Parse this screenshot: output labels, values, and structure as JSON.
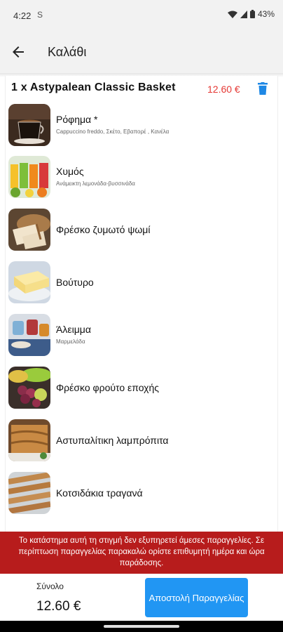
{
  "status": {
    "time": "4:22",
    "sim_icon": "S",
    "battery": "43%"
  },
  "header": {
    "title": "Καλάθι",
    "back_icon": "arrow-back-icon"
  },
  "basket": {
    "title": "1 x Astypalean Classic Basket",
    "price": "12.60 €",
    "price_color": "#e53935",
    "delete_icon": "trash-icon"
  },
  "items": [
    {
      "name": "Ρόφημα *",
      "sub": "Cappuccino freddo, Σκέτο, Εβαπορέ , Κανέλα"
    },
    {
      "name": "Χυμός",
      "sub": "Ανάμεικτη λεμονάδα-βυσσινάδα"
    },
    {
      "name": "Φρέσκο ζυμωτό ψωμί",
      "sub": ""
    },
    {
      "name": "Βούτυρο",
      "sub": ""
    },
    {
      "name": "Άλειμμα",
      "sub": "Μαρμελάδα"
    },
    {
      "name": "Φρέσκο φρούτο εποχής",
      "sub": ""
    },
    {
      "name": "Αστυπαλίτικη λαμπρόπιτα",
      "sub": ""
    },
    {
      "name": "Κοτσιδάκια τραγανά",
      "sub": ""
    }
  ],
  "notice": {
    "text": "Το κατάστημα αυτή τη στιγμή δεν εξυπηρετεί άμεσες παραγγελίες. Σε περίπτωση παραγγελίας παρακαλώ ορίστε επιθυμητή ημέρα και ώρα παράδοσης.",
    "color": "#b71c1c"
  },
  "footer": {
    "total_label": "Σύνολο",
    "total_value": "12.60 €",
    "submit_label": "Αποστολή Παραγγελίας",
    "accent": "#2196f3"
  }
}
